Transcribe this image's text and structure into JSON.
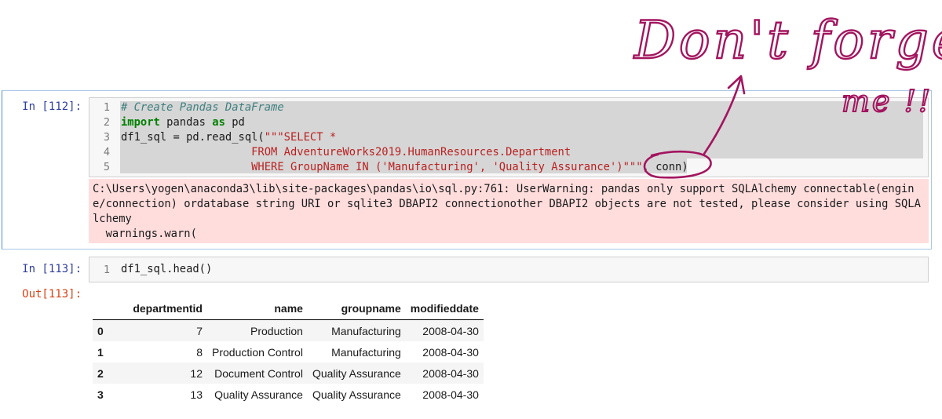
{
  "cells": [
    {
      "prompt": "In [112]:",
      "line_numbers": [
        "1",
        "2",
        "3",
        "4",
        "5"
      ],
      "code_lines": [
        [
          {
            "t": "# Create Pandas DataFrame",
            "c": "cm-comment"
          }
        ],
        [
          {
            "t": "import",
            "c": "cm-kw"
          },
          {
            "t": " pandas ",
            "c": ""
          },
          {
            "t": "as",
            "c": "cm-kw"
          },
          {
            "t": " pd",
            "c": ""
          }
        ],
        [
          {
            "t": "df1_sql = pd.read_sql(",
            "c": ""
          },
          {
            "t": "\"\"\"SELECT *",
            "c": "cm-str"
          }
        ],
        [
          {
            "t": "                    FROM AdventureWorks2019.HumanResources.Department",
            "c": "cm-str"
          }
        ],
        [
          {
            "t": "                    WHERE GroupName IN ('Manufacturing', 'Quality Assurance')\"\"\"",
            "c": "cm-str"
          },
          {
            "t": ", conn)",
            "c": ""
          }
        ]
      ],
      "warning_lines": [
        "C:\\Users\\yogen\\anaconda3\\lib\\site-packages\\pandas\\io\\sql.py:761: UserWarning: pandas only support SQLAlchemy connectable(engin",
        "e/connection) ordatabase string URI or sqlite3 DBAPI2 connectionother DBAPI2 objects are not tested, please consider using SQLA",
        "lchemy",
        "  warnings.warn("
      ]
    },
    {
      "prompt": "In [113]:",
      "line_number": "1",
      "code": "df1_sql.head()",
      "out_prompt": "Out[113]:"
    }
  ],
  "dataframe": {
    "columns": [
      "departmentid",
      "name",
      "groupname",
      "modifieddate"
    ],
    "rows": [
      {
        "index": "0",
        "departmentid": "7",
        "name": "Production",
        "groupname": "Manufacturing",
        "modifieddate": "2008-04-30"
      },
      {
        "index": "1",
        "departmentid": "8",
        "name": "Production Control",
        "groupname": "Manufacturing",
        "modifieddate": "2008-04-30"
      },
      {
        "index": "2",
        "departmentid": "12",
        "name": "Document Control",
        "groupname": "Quality Assurance",
        "modifieddate": "2008-04-30"
      },
      {
        "index": "3",
        "departmentid": "13",
        "name": "Quality Assurance",
        "groupname": "Quality Assurance",
        "modifieddate": "2008-04-30"
      }
    ]
  },
  "annotation": {
    "line1": "Don't forget",
    "line2": "me !!",
    "color": "#a3155f"
  }
}
